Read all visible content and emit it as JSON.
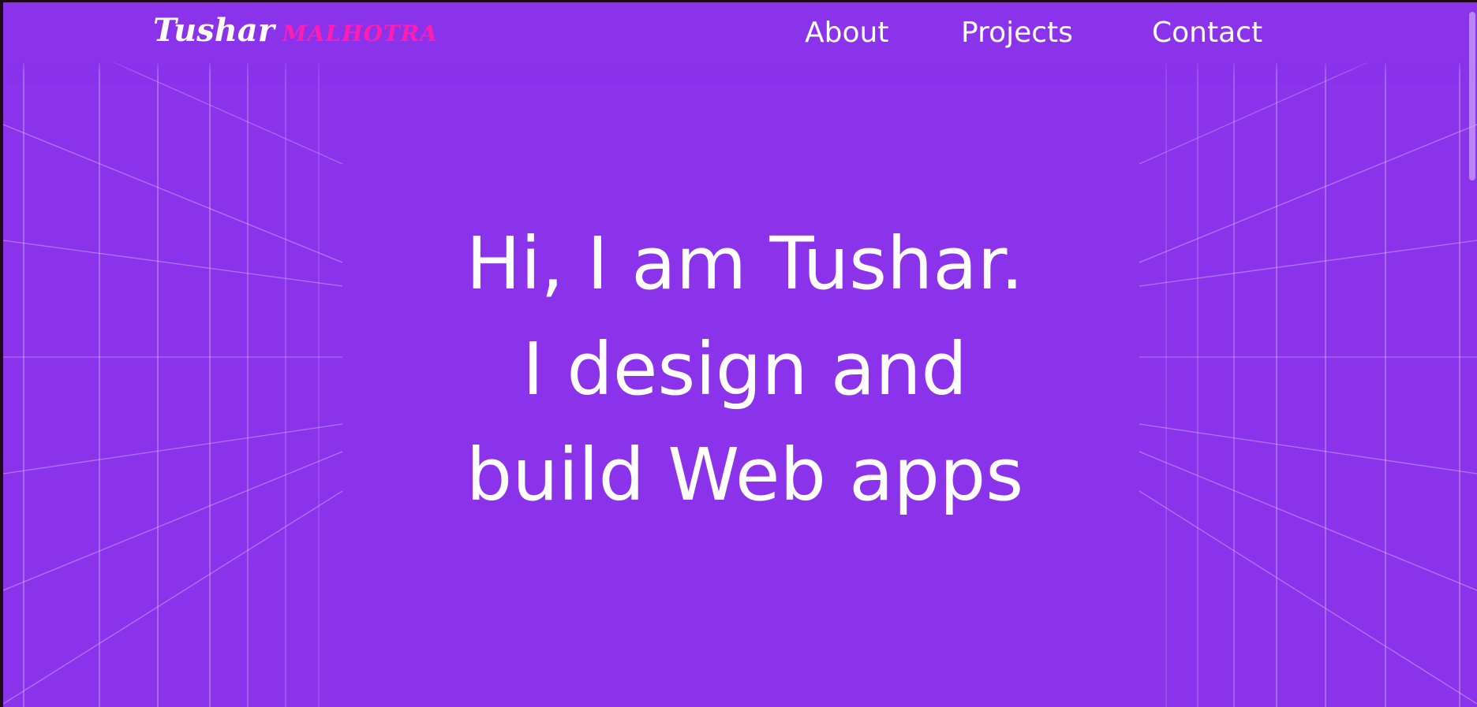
{
  "logo": {
    "first_name": "Tushar",
    "last_name": "MALHOTRA"
  },
  "nav": {
    "about": "About",
    "projects": "Projects",
    "contact": "Contact"
  },
  "hero": {
    "line1": "Hi, I am Tushar.",
    "line2": "I design and",
    "line3": "build Web apps"
  },
  "colors": {
    "background": "#8b33eb",
    "accent": "#ff1eb0",
    "text": "#ffffff",
    "grid_lines": "#d8b6ff"
  }
}
